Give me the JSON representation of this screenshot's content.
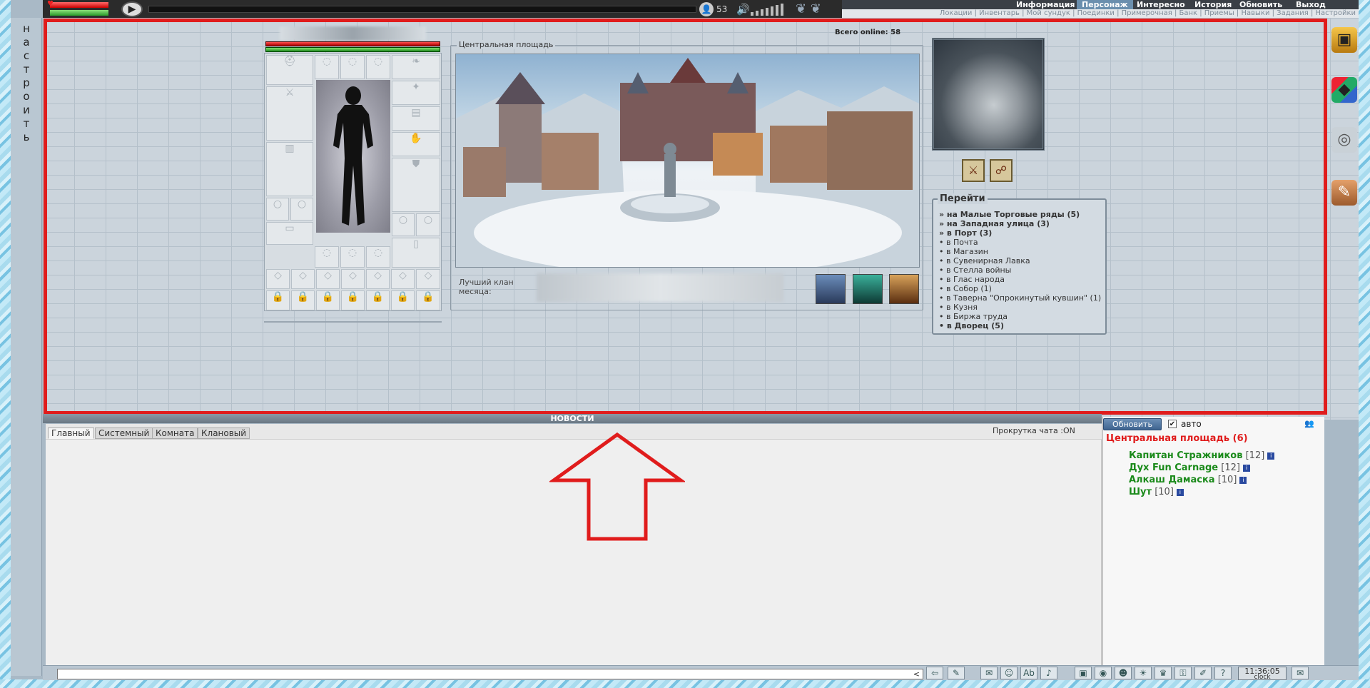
{
  "settings_strip": {
    "letters": [
      "н",
      "а",
      "с",
      "т",
      "р",
      "о",
      "и",
      "т",
      "ь"
    ]
  },
  "topbar": {
    "online_count": "53",
    "play_glyph": "▶",
    "volume_glyph": "🔊",
    "online_glyph": "👤"
  },
  "menu": {
    "items": [
      "Информация",
      "Персонаж",
      "Интересно",
      "История",
      "Обновить",
      "Выход"
    ],
    "sub": "Локации | Инвентарь | Мой сундук | Поединки | Примерочная | Банк | Приемы | Навыки | Задания | Настройки"
  },
  "location": {
    "title": "Центральная площадь",
    "online_total": "Всего online: 58",
    "best_clan_label": "Лучший клан месяца:"
  },
  "goto": {
    "title": "Перейти",
    "items": [
      {
        "text": "» на Малые Торговые ряды (5)",
        "bold": true
      },
      {
        "text": "» на Западная улица (3)",
        "bold": true
      },
      {
        "text": "» в Порт (3)",
        "bold": true
      },
      {
        "text": "• в Почта",
        "bold": false
      },
      {
        "text": "• в Магазин",
        "bold": false
      },
      {
        "text": "• в Сувенирная Лавка",
        "bold": false
      },
      {
        "text": "• в Стелла войны",
        "bold": false
      },
      {
        "text": "• в Глас народа",
        "bold": false
      },
      {
        "text": "• в Собор (1)",
        "bold": false
      },
      {
        "text": "• в Таверна \"Опрокинутый кувшин\" (1)",
        "bold": false
      },
      {
        "text": "• в Кузня",
        "bold": false
      },
      {
        "text": "• в Биржа труда",
        "bold": false
      },
      {
        "text": "• в Дворец (5)",
        "bold": true
      }
    ]
  },
  "news": {
    "label": "НОВОСТИ"
  },
  "chat": {
    "tabs": [
      "Главный",
      "Системный",
      "Комната",
      "Клановый"
    ],
    "scroll_state": "Прокрутка чата :ON",
    "input_value": "<"
  },
  "who": {
    "refresh_label": "Обновить",
    "auto_label": "авто",
    "auto_checked": "✔",
    "room_title": "Центральная площадь (6)",
    "users": [
      {
        "name": "Капитан Стражников",
        "level": "[12]"
      },
      {
        "name": "Дух Fun Carnage",
        "level": "[12]"
      },
      {
        "name": "Алкаш Дамаска",
        "level": "[10]"
      },
      {
        "name": "Шут",
        "level": "[10]"
      }
    ]
  },
  "clock": {
    "time": "11:36:05",
    "label": "clock"
  },
  "colors": {
    "highlight": "#e01c1c",
    "user_name": "#1a8a1a",
    "room_title": "#e01c1c",
    "menu_active": "#6b8fae"
  }
}
